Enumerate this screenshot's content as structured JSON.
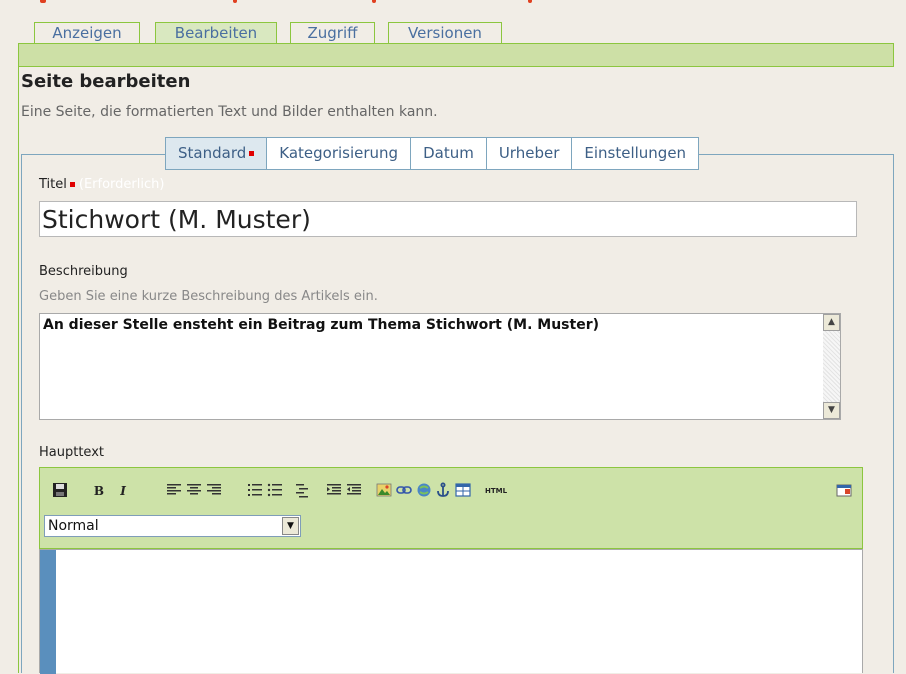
{
  "main_tabs": [
    {
      "label": "Anzeigen",
      "active": false
    },
    {
      "label": "Bearbeiten",
      "active": true
    },
    {
      "label": "Zugriff",
      "active": false
    },
    {
      "label": "Versionen",
      "active": false
    }
  ],
  "page": {
    "title": "Seite bearbeiten",
    "description": "Eine Seite, die formatierten Text und Bilder enthalten kann."
  },
  "sub_tabs": [
    {
      "label": "Standard",
      "active": true,
      "required": true
    },
    {
      "label": "Kategorisierung",
      "active": false
    },
    {
      "label": "Datum",
      "active": false
    },
    {
      "label": "Urheber",
      "active": false
    },
    {
      "label": "Einstellungen",
      "active": false
    }
  ],
  "fields": {
    "title_label": "Titel",
    "title_required": "(Erforderlich)",
    "title_value": "Stichwort (M. Muster)",
    "description_label": "Beschreibung",
    "description_hint": "Geben Sie eine kurze Beschreibung des Artikels ein.",
    "description_value": "An dieser Stelle ensteht ein Beitrag zum Thema Stichwort (M. Muster)",
    "body_label": "Haupttext"
  },
  "editor": {
    "toolbar": {
      "bold": "B",
      "italic": "I",
      "html": "HTML"
    },
    "format_value": "Normal"
  },
  "colors": {
    "accent_green": "#8cc63f",
    "header_green": "#cde0a6",
    "tab_blue": "#7ea6be",
    "required_red": "#e00000"
  }
}
